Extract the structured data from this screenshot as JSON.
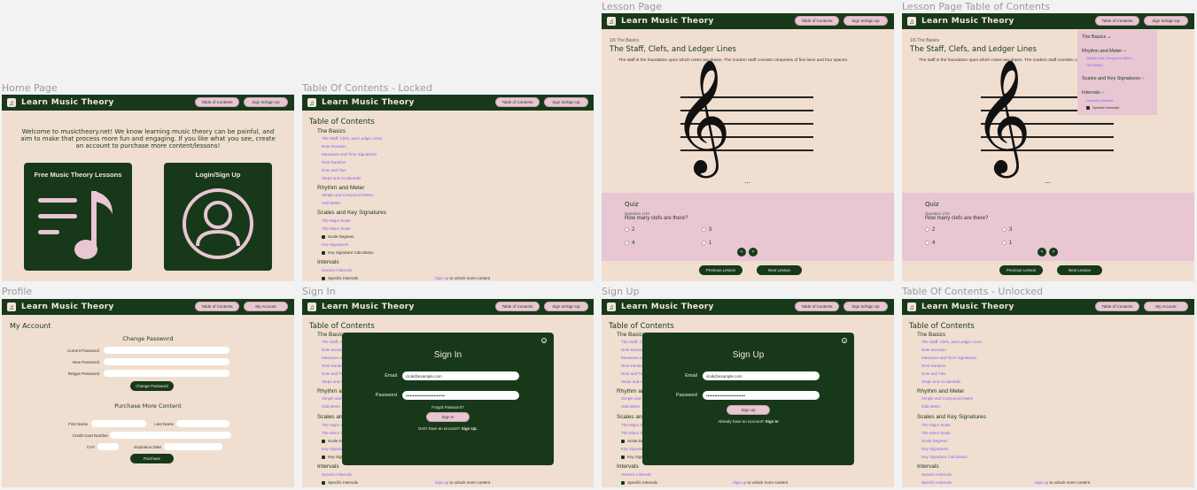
{
  "frames": {
    "home": "Home Page",
    "toc_locked": "Table Of Contents - Locked",
    "lesson": "Lesson Page",
    "lesson_toc": "Lesson Page Table of Contents",
    "profile": "Profile",
    "signin": "Sign In",
    "signup": "Sign Up",
    "toc_unlocked": "Table Of Contents - Unlocked"
  },
  "nav": {
    "brand": "Learn Music Theory",
    "toc": "Table of Contents",
    "signin": "Sign In/Sign Up",
    "account": "My Account"
  },
  "home": {
    "welcome": "Welcome to musictheory.net! We know learning music theory can be painful, and aim to make that process more fun and engaging. If you like what you see, create an account to purchase more content/lessons!",
    "card1": "Free Music Theory Lessons",
    "card2": "Login/Sign Up"
  },
  "toc": {
    "title": "Table of Contents",
    "basics": "The Basics",
    "basics_items": [
      "The Staff, Clefs, and Ledger Lines",
      "Note Duration",
      "Measures and Time Signatures",
      "Rest Duration",
      "Dots and Ties",
      "Steps and Accidentals"
    ],
    "rhythm": "Rhythm and Meter",
    "rhythm_items": [
      "Simple and Compound Meter",
      "Odd Meter"
    ],
    "scales": "Scales and Key Signatures",
    "scales_items": [
      "The Major Scale",
      "The Minor Scale",
      "Scale Degrees",
      "Key Signatures",
      "Key Signature Calculation"
    ],
    "intervals": "Intervals",
    "intervals_items": [
      "Generic Intervals",
      "Specific Intervals"
    ],
    "signup_link": "Sign up",
    "signup_rest": "to unlock more content"
  },
  "lesson": {
    "progress": "1/6 The Basics",
    "title": "The Staff, Clefs, and Ledger Lines",
    "body": "The staff is the foundation upon which notes are drawn. The modern staff consists comprises of five lines and four spaces.",
    "ellipsis": "...",
    "quiz": "Quiz",
    "question_no": "Question 1/10",
    "question": "How many clefs are there?",
    "answers": [
      "2",
      "3",
      "4",
      "1"
    ],
    "prev": "Previous Lesson",
    "next": "Next Lesson",
    "toc_dd": {
      "basics": "The Basics ⌄",
      "rhythm": "Rhythm and Meter –",
      "rhythm_items": [
        "Simple and Compound Meter",
        "Odd Meter"
      ],
      "scales": "Scales and Key Signatures –",
      "intervals": "Intervals –",
      "intervals_items": [
        "Generic Intervals",
        "Specific Intervals"
      ]
    }
  },
  "profile": {
    "title": "My Account",
    "change_pw": "Change Password",
    "current": "Current Password",
    "new": "New Password",
    "retype": "Retype Password",
    "change_btn": "Change Password",
    "purchase": "Purchase More Content",
    "first": "First Name",
    "last": "Last Name",
    "cc": "Credit Card Number",
    "cvv": "CVV",
    "exp": "Expiration Date",
    "purchase_btn": "Purchase"
  },
  "signin": {
    "title": "Sign In",
    "email_label": "Email",
    "email_value": "cindi@example.com",
    "password_label": "Password",
    "password_value": "••••••••••••••••••••••••••••",
    "forgot": "Forgot Password?",
    "btn": "Sign In",
    "no_account": "Don't have an account?",
    "signup": "Sign Up."
  },
  "signup": {
    "title": "Sign Up",
    "btn": "Sign Up",
    "have_account": "Already have an account?",
    "signin": "Sign In"
  },
  "colors": {
    "dark_green": "#17391a",
    "beige": "#f0dfd0",
    "pink": "#e8c6d2",
    "link": "#8b5cf6"
  }
}
